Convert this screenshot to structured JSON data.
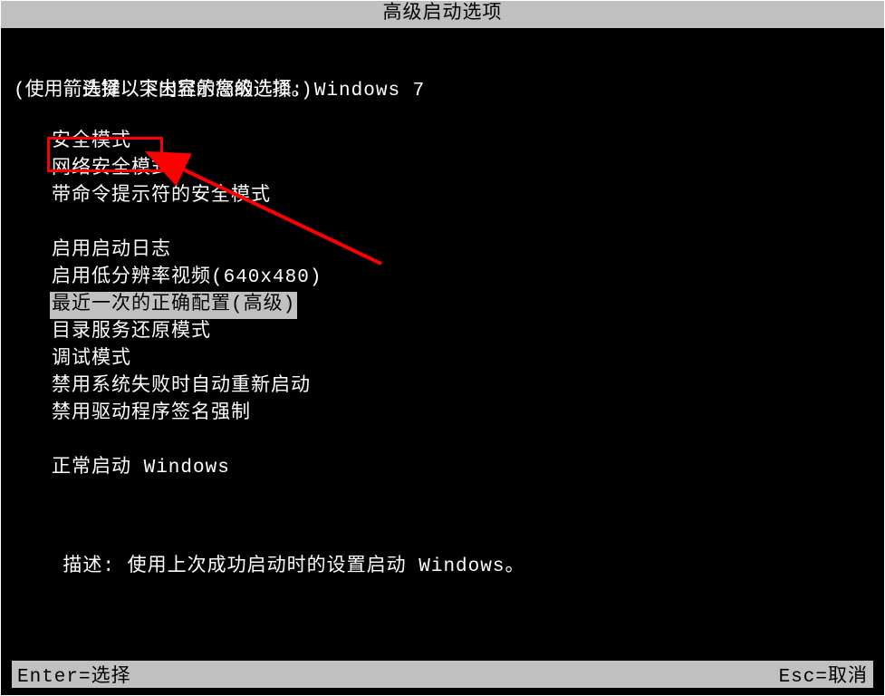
{
  "title": "高级启动选项",
  "header_line1_prefix": "选择以下内容的高级选项: ",
  "os_name": "Windows 7",
  "header_line2": "(使用箭头键以突出显示您的选择。)",
  "options_group1": [
    "安全模式",
    "网络安全模式",
    "带命令提示符的安全模式"
  ],
  "options_group2": [
    "启用启动日志",
    "启用低分辨率视频(640x480)",
    "最近一次的正确配置(高级)",
    "目录服务还原模式",
    "调试模式",
    "禁用系统失败时自动重新启动",
    "禁用驱动程序签名强制"
  ],
  "options_group3": [
    "正常启动 Windows"
  ],
  "selected_option": "最近一次的正确配置(高级)",
  "boxed_option": "安全模式",
  "desc_label": "描述: ",
  "desc_text": "使用上次成功启动时的设置启动 Windows。",
  "footer_left": "Enter=选择",
  "footer_right": "Esc=取消",
  "annotation_color": "#ff0000"
}
